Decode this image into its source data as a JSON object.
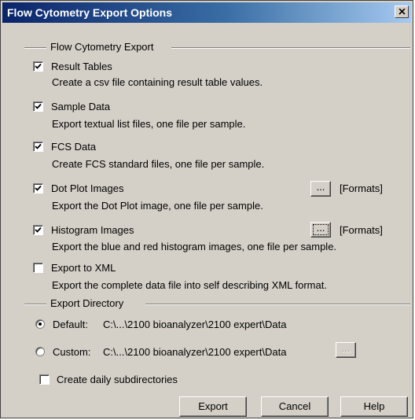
{
  "window": {
    "title": "Flow Cytometry Export Options"
  },
  "export_group": {
    "label": "Flow Cytometry Export",
    "options": [
      {
        "label": "Result Tables",
        "description": "Create a csv file containing result table values.",
        "checked": true
      },
      {
        "label": "Sample Data",
        "description": "Export textual list files, one file per sample.",
        "checked": true
      },
      {
        "label": "FCS Data",
        "description": "Create FCS standard files, one file per sample.",
        "checked": true
      },
      {
        "label": "Dot Plot Images",
        "description": "Export the Dot Plot image, one file per sample.",
        "checked": true,
        "browse_label": "...",
        "formats_label": "[Formats]"
      },
      {
        "label": "Histogram Images",
        "description": "Export the blue and red histogram images, one file per sample.",
        "checked": true,
        "browse_label": "...",
        "formats_label": "[Formats]"
      },
      {
        "label": "Export to XML",
        "description": "Export the complete data file into self describing XML format.",
        "checked": false
      }
    ]
  },
  "directory_group": {
    "label": "Export Directory",
    "default_label": "Default:",
    "default_path": "C:\\...\\2100 bioanalyzer\\2100 expert\\Data",
    "custom_label": "Custom:",
    "custom_path": "C:\\...\\2100 bioanalyzer\\2100 expert\\Data",
    "custom_browse_label": "...",
    "selected": "default"
  },
  "daily_subdirectories": {
    "label": "Create daily subdirectories",
    "checked": false
  },
  "buttons": {
    "export": "Export",
    "cancel": "Cancel",
    "help": "Help"
  }
}
